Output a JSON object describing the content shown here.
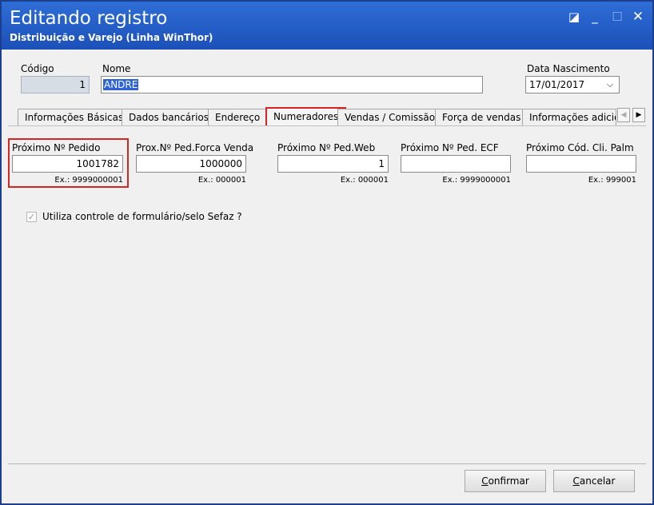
{
  "window": {
    "title": "Editando registro",
    "subtitle": "Distribuição e Varejo (Linha WinThor)",
    "controls": {
      "restore": "◪",
      "minimize": "_",
      "maximize": "☐",
      "close": "✕"
    }
  },
  "header": {
    "codigo_label": "Código",
    "codigo_value": "1",
    "nome_label": "Nome",
    "nome_value": "ANDRE",
    "data_label": "Data Nascimento",
    "data_value": "17/01/2017"
  },
  "tabs": [
    {
      "label": "Informações Básicas"
    },
    {
      "label": "Dados bancários"
    },
    {
      "label": "Endereço"
    },
    {
      "label": "Numeradores",
      "active": true
    },
    {
      "label": "Vendas  / Comissão"
    },
    {
      "label": "Força de vendas"
    },
    {
      "label": "Informações adicion"
    }
  ],
  "numeradores": {
    "fields": [
      {
        "label": "Próximo Nº Pedido",
        "value": "1001782",
        "example": "Ex.:  9999000001"
      },
      {
        "label": "Prox.Nº Ped.Forca Venda",
        "value": "1000000",
        "example": "Ex.:  000001"
      },
      {
        "label": "Próximo Nº Ped.Web",
        "value": "1",
        "example": "Ex.:  000001"
      },
      {
        "label": "Próximo Nº Ped. ECF",
        "value": "",
        "example": "Ex.:  9999000001"
      },
      {
        "label": "Próximo Cód. Cli. Palm",
        "value": "",
        "example": "Ex.:  999001"
      }
    ],
    "checkbox_label": "Utiliza controle de formulário/selo Sefaz ?",
    "checkbox_checked": true
  },
  "footer": {
    "confirm_first": "C",
    "confirm_rest": "onfirmar",
    "cancel_first": "C",
    "cancel_rest": "ancelar"
  },
  "colors": {
    "titlebar": "#1b50b8",
    "highlight": "#d62424",
    "selection": "#2d63d9"
  }
}
